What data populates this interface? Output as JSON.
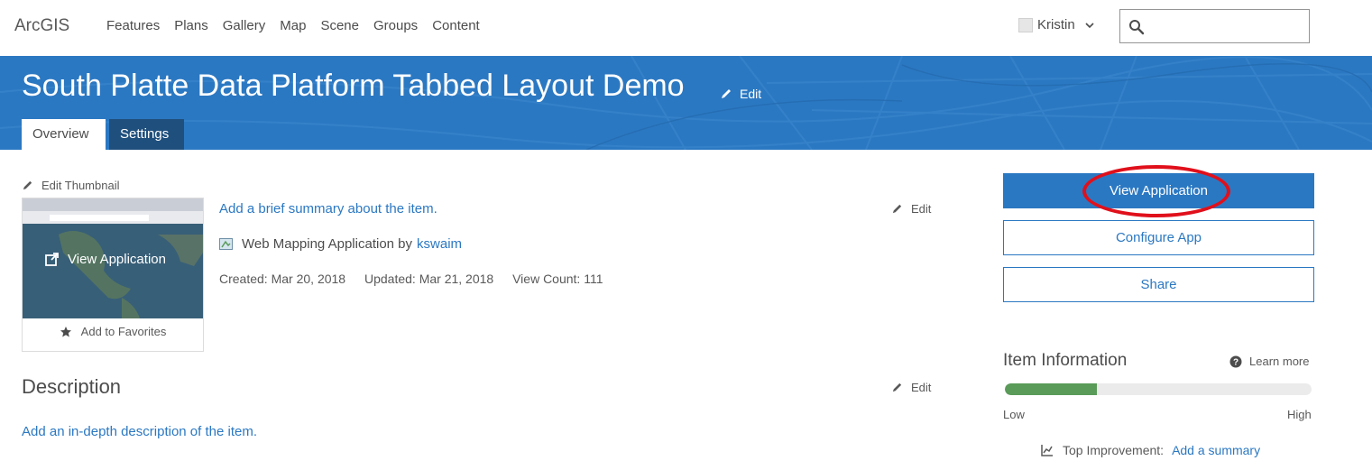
{
  "nav": {
    "brand": "ArcGIS",
    "links": [
      "Features",
      "Plans",
      "Gallery",
      "Map",
      "Scene",
      "Groups",
      "Content"
    ],
    "user_name": "Kristin",
    "search_value": ""
  },
  "banner": {
    "title": "South Platte Data Platform Tabbed Layout Demo",
    "edit_label": "Edit",
    "tabs": [
      "Overview",
      "Settings"
    ],
    "active_tab": "Overview"
  },
  "item": {
    "edit_thumbnail_label": "Edit Thumbnail",
    "thumbnail_action_label": "View Application",
    "add_favorites_label": "Add to Favorites",
    "summary_placeholder": "Add a brief summary about the item.",
    "summary_edit_label": "Edit",
    "type_text": "Web Mapping Application by",
    "owner": "kswaim",
    "created": "Created: Mar 20, 2018",
    "updated": "Updated: Mar 21, 2018",
    "view_count": "View Count: 111"
  },
  "description": {
    "heading": "Description",
    "edit_label": "Edit",
    "placeholder": "Add an in-depth description of the item."
  },
  "actions": {
    "view_application": "View Application",
    "configure_app": "Configure App",
    "share": "Share"
  },
  "item_information": {
    "heading": "Item Information",
    "learn_more": "Learn more",
    "score_fraction": 0.3,
    "low_label": "Low",
    "high_label": "High",
    "top_improvement_label": "Top Improvement:",
    "top_improvement_link": "Add a summary"
  },
  "colors": {
    "brand_blue": "#2b78c2",
    "banner_blue": "#2b78c2",
    "settings_tab": "#1f4f7d",
    "progress_green": "#5a9b59",
    "annotation_red": "#e0101b"
  },
  "icons": [
    "user-avatar-icon",
    "chevron-down-icon",
    "search-icon",
    "pencil-icon",
    "external-link-icon",
    "star-icon",
    "web-app-icon",
    "help-circle-icon",
    "chart-icon"
  ]
}
